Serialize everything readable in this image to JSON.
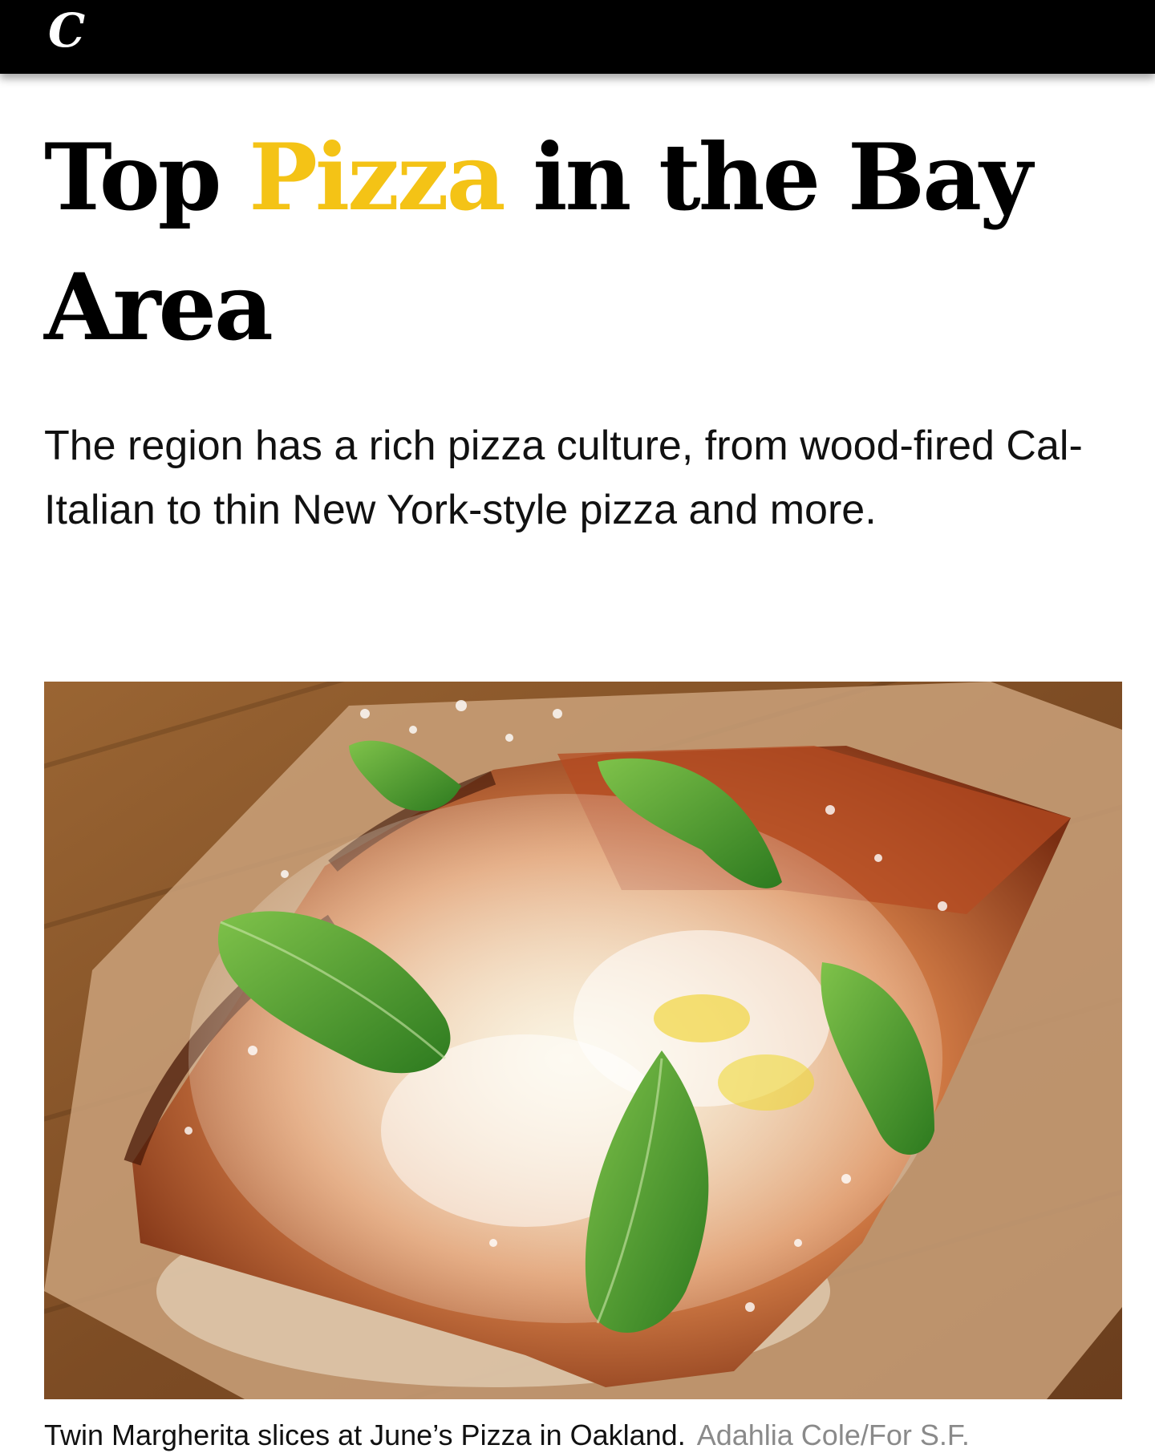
{
  "header": {
    "logo_text": "C",
    "background": "#000000"
  },
  "article": {
    "headline": {
      "part1": "Top ",
      "highlight": "Pizza",
      "part2": " in the Bay Area",
      "highlight_color": "#f4c316"
    },
    "dek": "The region has a rich pizza culture, from wood-fired Cal-Italian to thin New York-style pizza and more.",
    "image": {
      "caption": "Twin Margherita slices at June’s Pizza in Oakland.",
      "credit": "Adahlia Cole/For S.F."
    }
  }
}
